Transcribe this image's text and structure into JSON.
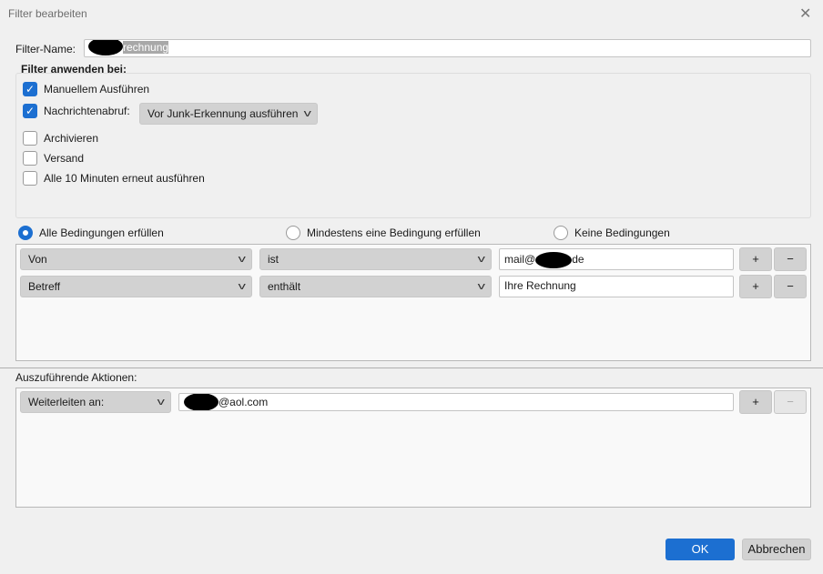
{
  "dialog": {
    "title": "Filter bearbeiten",
    "close_icon": "close-icon"
  },
  "filter_name": {
    "label": "Filter-Name:",
    "value_visible": "rechnung"
  },
  "apply": {
    "heading": "Filter anwenden bei:",
    "manual": {
      "label": "Manuellem Ausführen",
      "checked": true
    },
    "fetch": {
      "label": "Nachrichtenabruf:",
      "checked": true,
      "dropdown": "Vor Junk-Erkennung ausführen"
    },
    "archive": {
      "label": "Archivieren",
      "checked": false
    },
    "send": {
      "label": "Versand",
      "checked": false
    },
    "periodic": {
      "label": "Alle 10 Minuten erneut ausführen",
      "checked": false
    }
  },
  "match": {
    "options": [
      "Alle Bedingungen erfüllen",
      "Mindestens eine Bedingung erfüllen",
      "Keine Bedingungen"
    ],
    "selected": 0
  },
  "conditions": [
    {
      "field": "Von",
      "op": "ist",
      "value_prefix": "mail@",
      "value_suffix": "de"
    },
    {
      "field": "Betreff",
      "op": "enthält",
      "value": "Ihre Rechnung"
    }
  ],
  "actions": {
    "label": "Auszuführende Aktionen:",
    "rows": [
      {
        "action": "Weiterleiten an:",
        "value_suffix": "@aol.com"
      }
    ]
  },
  "buttons": {
    "plus": "+",
    "minus": "−",
    "ok": "OK",
    "cancel": "Abbrechen"
  },
  "colors": {
    "accent": "#1c6fd1"
  }
}
